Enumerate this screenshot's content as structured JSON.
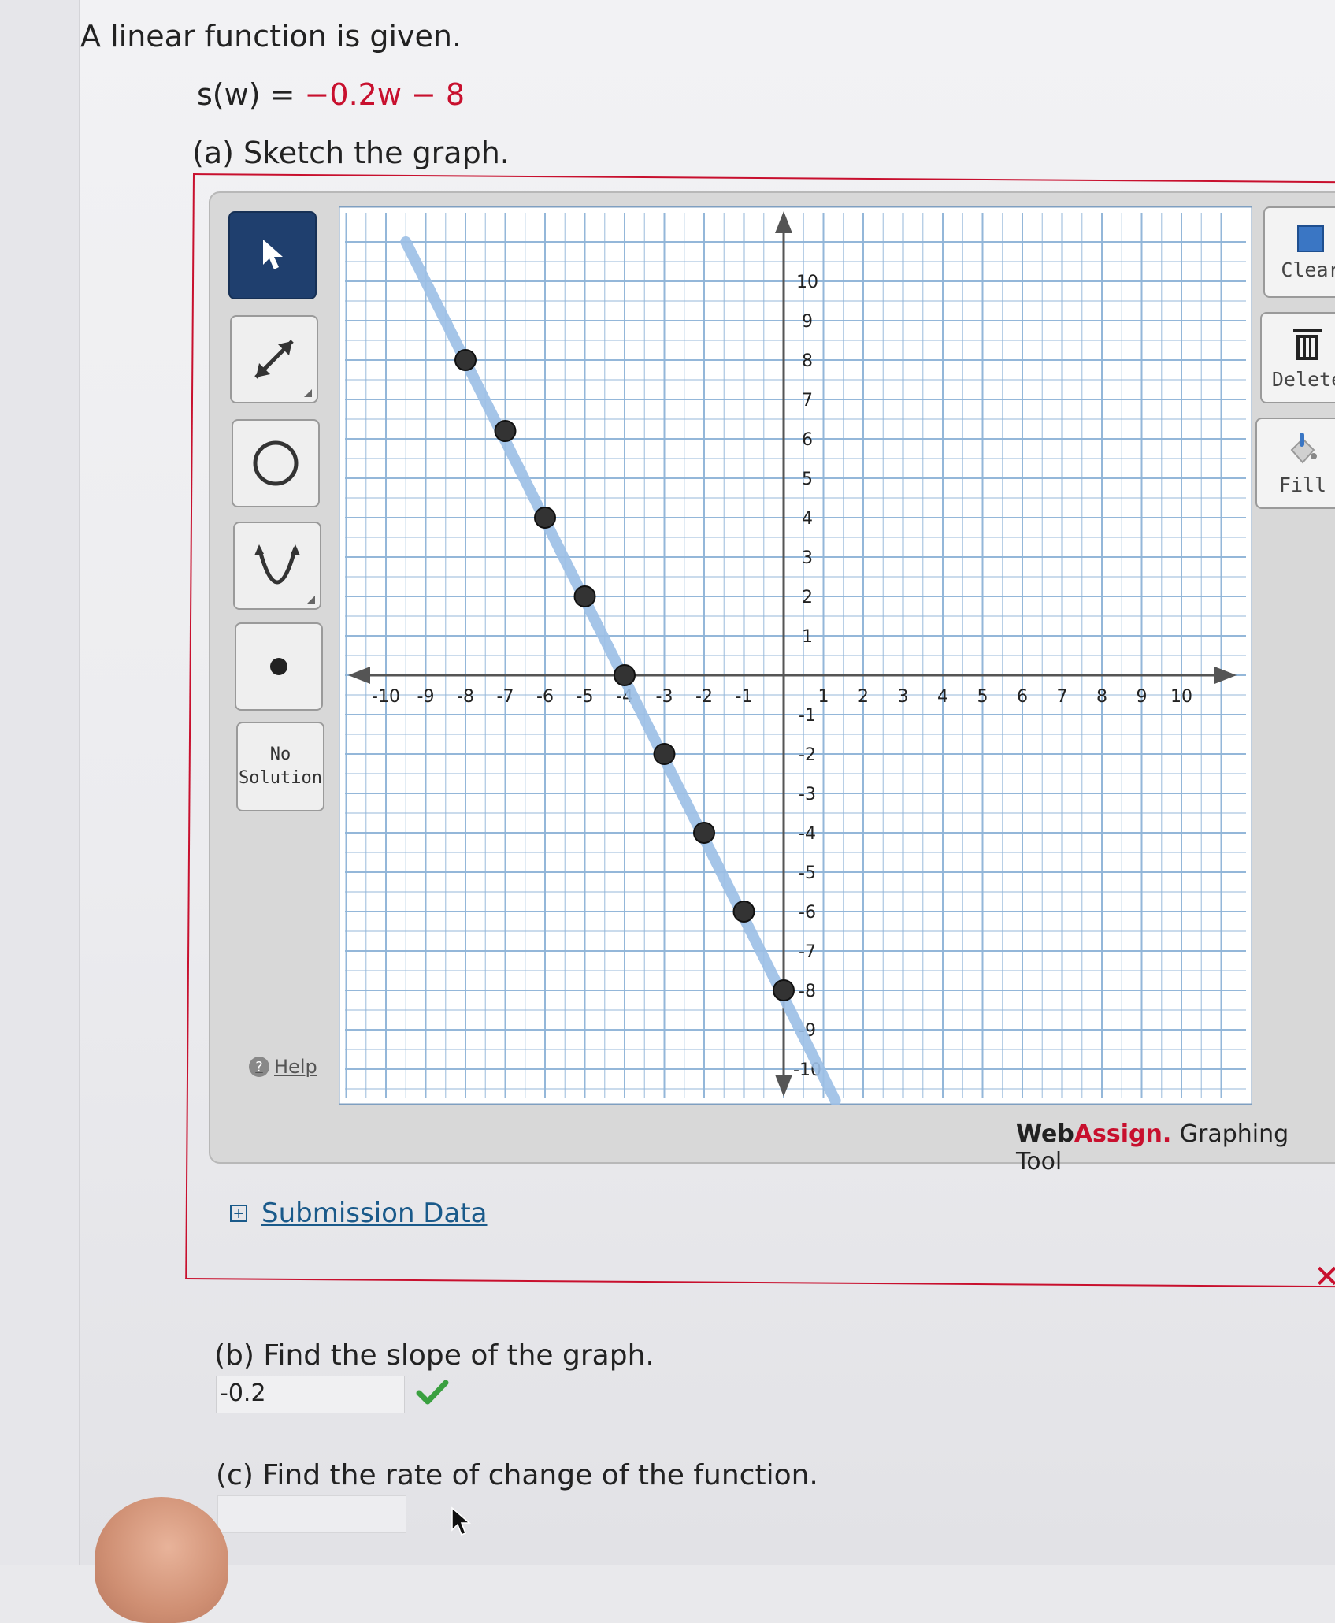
{
  "question": {
    "intro": "A linear function is given.",
    "function_lhs": "s(w) =",
    "function_rhs": "−0.2w − 8"
  },
  "parts": {
    "a": {
      "prompt": "(a) Sketch the graph."
    },
    "b": {
      "prompt": "(b) Find the slope of the graph.",
      "answer": "-0.2",
      "status": "correct"
    },
    "c": {
      "prompt": "(c) Find the rate of change of the function.",
      "answer": ""
    }
  },
  "toolbar": {
    "no_solution": "No Solution",
    "help": "Help",
    "clear_all": "Clear A",
    "delete": "Delete",
    "fill": "Fill"
  },
  "branding": {
    "web": "Web",
    "assign": "Assign.",
    "tool": "Graphing Tool"
  },
  "submission": {
    "label": "Submission Data",
    "status": "incorrect"
  },
  "colors": {
    "accent_red": "#c8102e",
    "link_blue": "#1a5a8a",
    "grid_line": "#8fb4d8",
    "plotted_line": "#9cbfe6",
    "active_tool": "#1f3f6e",
    "check_green": "#3aa040"
  },
  "graph": {
    "x_range": [
      -10,
      10
    ],
    "y_range": [
      -10,
      10
    ],
    "x_ticks": [
      "-10",
      "-9",
      "-8",
      "-7",
      "-6",
      "-5",
      "-4",
      "-3",
      "-2",
      "-1",
      "1",
      "2",
      "3",
      "4",
      "5",
      "6",
      "7",
      "8",
      "9",
      "10"
    ],
    "y_ticks": [
      "10",
      "9",
      "8",
      "7",
      "6",
      "5",
      "4",
      "3",
      "2",
      "1",
      "-1",
      "-2",
      "-3",
      "-4",
      "-5",
      "-6",
      "-7",
      "-8",
      "-9",
      "-10"
    ],
    "line": {
      "from": [
        -9.5,
        11
      ],
      "to": [
        1.3,
        -10.8
      ]
    },
    "points": [
      [
        -8,
        8
      ],
      [
        -7,
        6.2
      ],
      [
        -6,
        4
      ],
      [
        -5,
        2
      ],
      [
        -4,
        0
      ],
      [
        -3,
        -2
      ],
      [
        -2,
        -4
      ],
      [
        -1,
        -6
      ],
      [
        0,
        -8
      ]
    ]
  }
}
